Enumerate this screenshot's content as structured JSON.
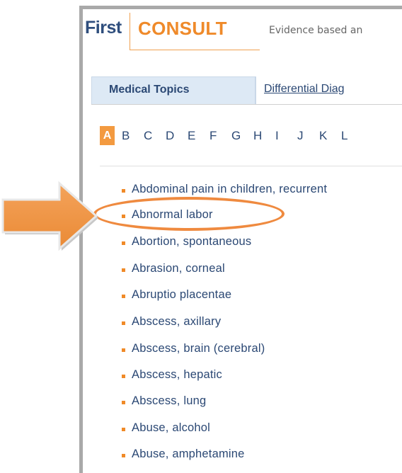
{
  "brand": {
    "first": "First",
    "consult": "CONSULT",
    "tagline": "Evidence based an"
  },
  "tabs": {
    "active": "Medical Topics",
    "other": "Differential Diag"
  },
  "alphabet": {
    "active": "A",
    "letters": [
      "B",
      "C",
      "D",
      "E",
      "F",
      "G",
      "H",
      "I",
      "J",
      "K",
      "L"
    ]
  },
  "topics": [
    "Abdominal pain in children, recurrent",
    "Abnormal labor",
    "Abortion, spontaneous",
    "Abrasion, corneal",
    "Abruptio placentae",
    "Abscess, axillary",
    "Abscess, brain (cerebral)",
    "Abscess, hepatic",
    "Abscess, lung",
    "Abuse, alcohol",
    "Abuse, amphetamine"
  ],
  "highlight": {
    "topic_index": 1,
    "color": "#ef8a3f"
  },
  "colors": {
    "link": "#2b4874",
    "accent": "#f08a28",
    "tab_bg": "#dde9f5",
    "brand_dark": "#2f4e7d"
  },
  "icons": {
    "pointer": "arrow-right-icon",
    "bullet": "square-bullet-icon"
  }
}
